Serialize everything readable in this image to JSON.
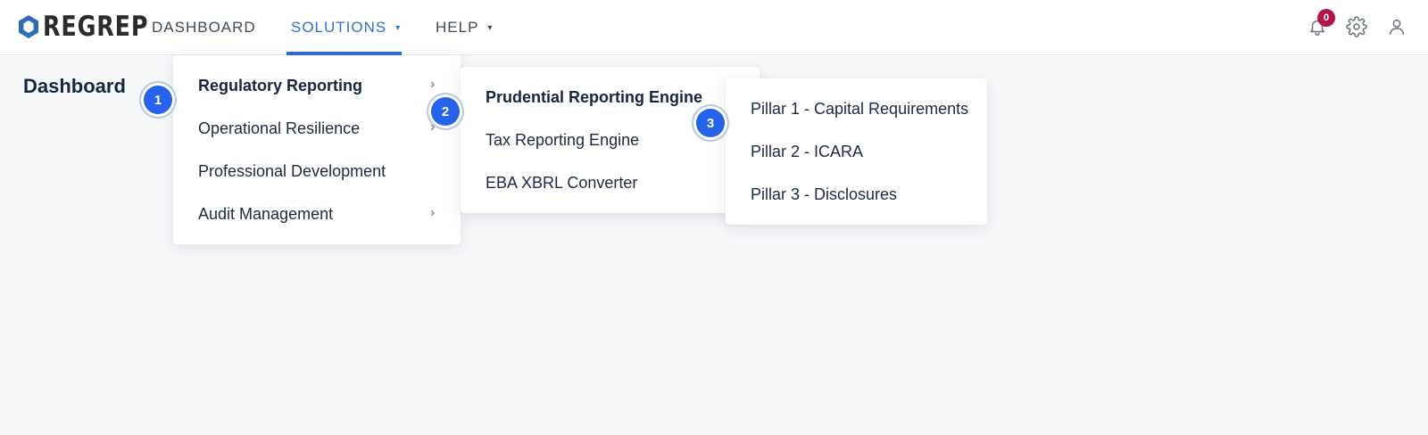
{
  "brand": {
    "name": "REGREP"
  },
  "nav": {
    "items": [
      {
        "label": "DASHBOARD",
        "has_caret": false
      },
      {
        "label": "SOLUTIONS",
        "has_caret": true,
        "active": true
      },
      {
        "label": "HELP",
        "has_caret": true
      }
    ],
    "caret_glyph": "▾"
  },
  "header_icons": {
    "notifications": {
      "icon": "bell-icon",
      "count": "0"
    },
    "settings": {
      "icon": "gear-icon"
    },
    "account": {
      "icon": "user-icon"
    }
  },
  "page": {
    "title": "Dashboard"
  },
  "menu_level1": {
    "items": [
      "Regulatory Reporting",
      "Operational Resilience",
      "Professional Development",
      "Audit Management"
    ]
  },
  "menu_level2": {
    "items": [
      "Prudential Reporting Engine",
      "Tax Reporting Engine",
      "EBA XBRL Converter"
    ]
  },
  "menu_level3": {
    "items": [
      "Pillar 1 - Capital Requirements",
      "Pillar 2 - ICARA",
      "Pillar 3 - Disclosures"
    ]
  },
  "chevron_glyph": "›",
  "steps": [
    "1",
    "2",
    "3"
  ],
  "colors": {
    "accent": "#2f6fd6",
    "badge": "#b1174a",
    "step": "#2563eb",
    "logo": "#2e6db4"
  }
}
